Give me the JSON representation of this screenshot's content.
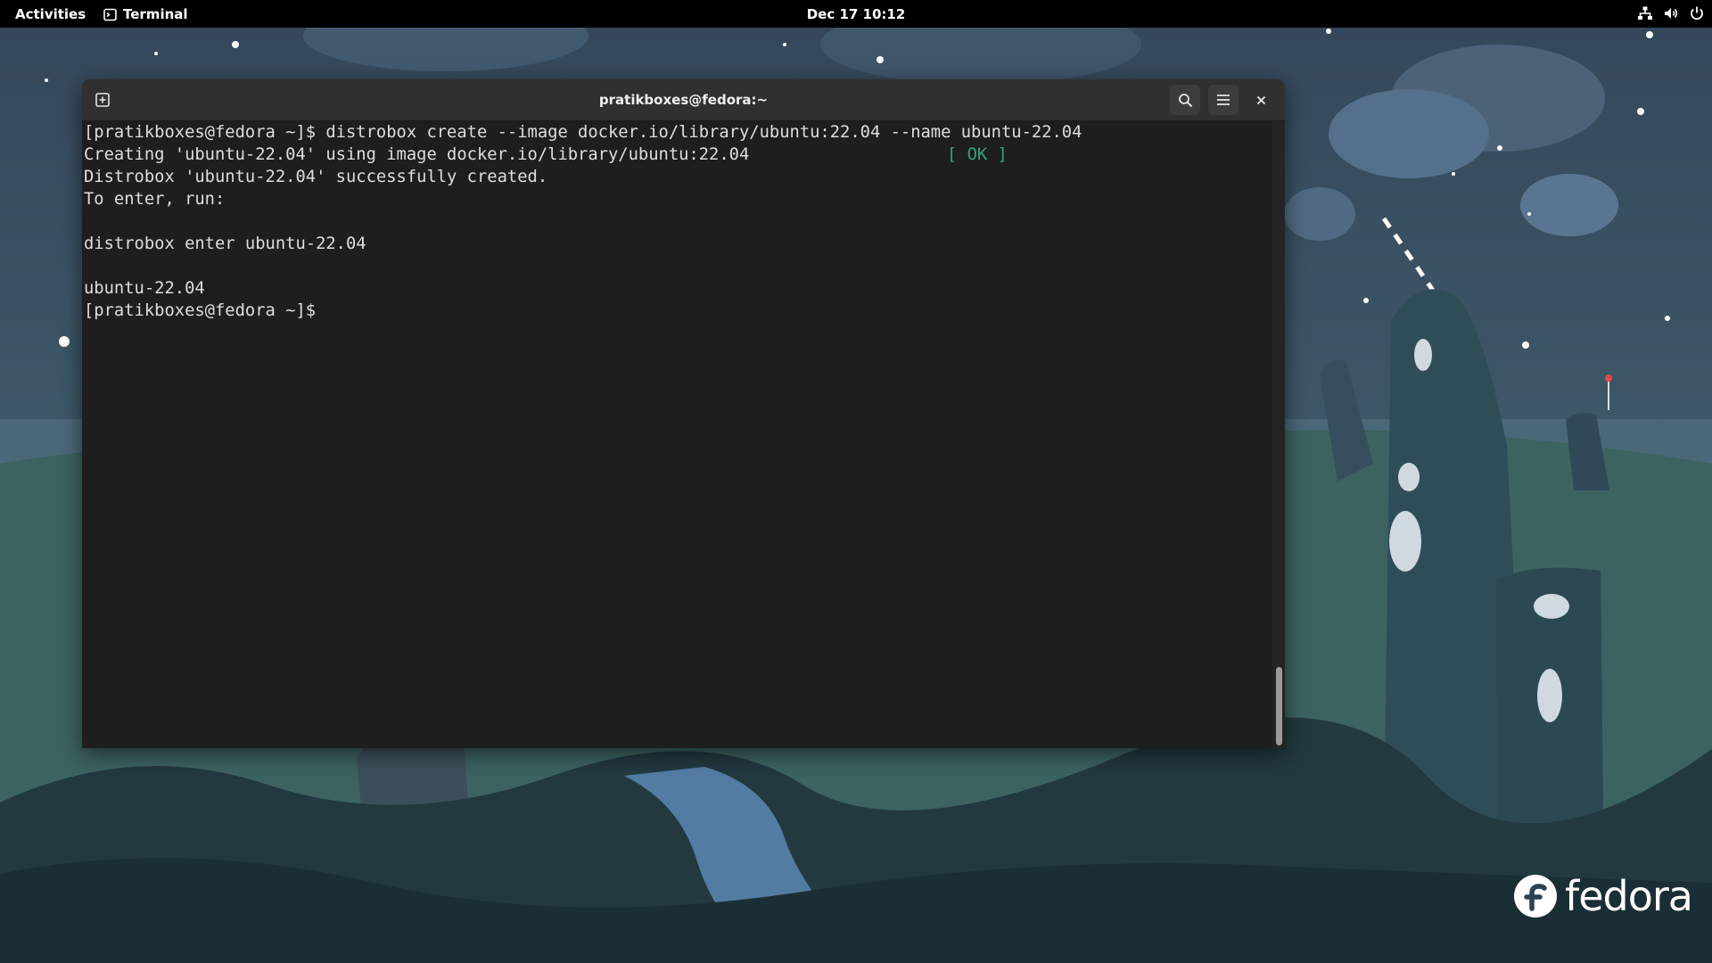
{
  "topbar": {
    "activities_label": "Activities",
    "app_name": "Terminal",
    "clock": "Dec 17  10:12",
    "tray_icons": [
      "network-icon",
      "volume-icon",
      "power-icon"
    ]
  },
  "terminal": {
    "window_title": "pratikboxes@fedora:~",
    "lines": [
      "[pratikboxes@fedora ~]$ distrobox create --image docker.io/library/ubuntu:22.04 --name ubuntu-22.04",
      "Creating 'ubuntu-22.04' using image docker.io/library/ubuntu:22.04",
      "Distrobox 'ubuntu-22.04' successfully created.",
      "To enter, run:",
      "",
      "distrobox enter ubuntu-22.04",
      "",
      "ubuntu-22.04",
      "[pratikboxes@fedora ~]$"
    ],
    "status_ok": "[ OK ]"
  },
  "desktop": {
    "logo_text": "fedora"
  },
  "colors": {
    "topbar_bg": "#000000",
    "terminal_bg": "#1e1e1e",
    "headerbar_bg": "#303030",
    "terminal_text": "#dedede",
    "ok_green": "#2ea675"
  }
}
